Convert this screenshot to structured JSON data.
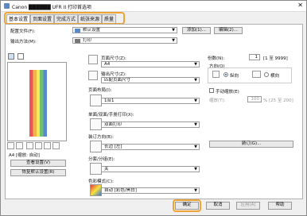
{
  "window": {
    "title": "Canon ██████ UFR II 打印首选项",
    "close": "✕"
  },
  "tabs": [
    {
      "label": "基本设置"
    },
    {
      "label": "页面设置"
    },
    {
      "label": "完成方式"
    },
    {
      "label": "纸张来源"
    },
    {
      "label": "质量"
    }
  ],
  "profile": {
    "label": "配置文件(F):",
    "value": "默认设置",
    "add": "添加(1)...",
    "edit": "编辑(2)..."
  },
  "output": {
    "label": "输出方法(M):",
    "value": "打印"
  },
  "page": {
    "size_label": "页面尺寸(Z):",
    "size_value": "A4",
    "out_label": "输出尺寸(Z):",
    "out_value": "匹配页面尺寸",
    "layout_label": "页面布局(I):",
    "layout_value": "1合1",
    "duplex_label": "单面/双面/手册打印(X):",
    "duplex_value": "双面打印",
    "binding_label": "装订方向(B):",
    "binding_value": "长边 [左]",
    "collate_label": "分套/分组(E):",
    "collate_value": "关",
    "color_label": "色彩模式(C):",
    "color_value": "自动 [彩色/黑白]"
  },
  "copies": {
    "label": "份数(N):",
    "value": "1",
    "range": "[1 至 9999]"
  },
  "orientation": {
    "label": "方向(O)",
    "portrait": "纵向",
    "landscape": "横向"
  },
  "manual_scale": {
    "label": "手动缩放(E)",
    "scale_label": "缩放(T):",
    "value": "100",
    "range": "% [25 至 200]"
  },
  "stamp_btn": "骑订(G)...",
  "preview": {
    "caption": "A4 [缩放: 自动]",
    "view_btn": "查看设置(V)",
    "restore_btn": "恢复默认设置(R)"
  },
  "footer": {
    "ok": "确定",
    "cancel": "取消",
    "apply": "应用(A)",
    "help": "帮助"
  }
}
